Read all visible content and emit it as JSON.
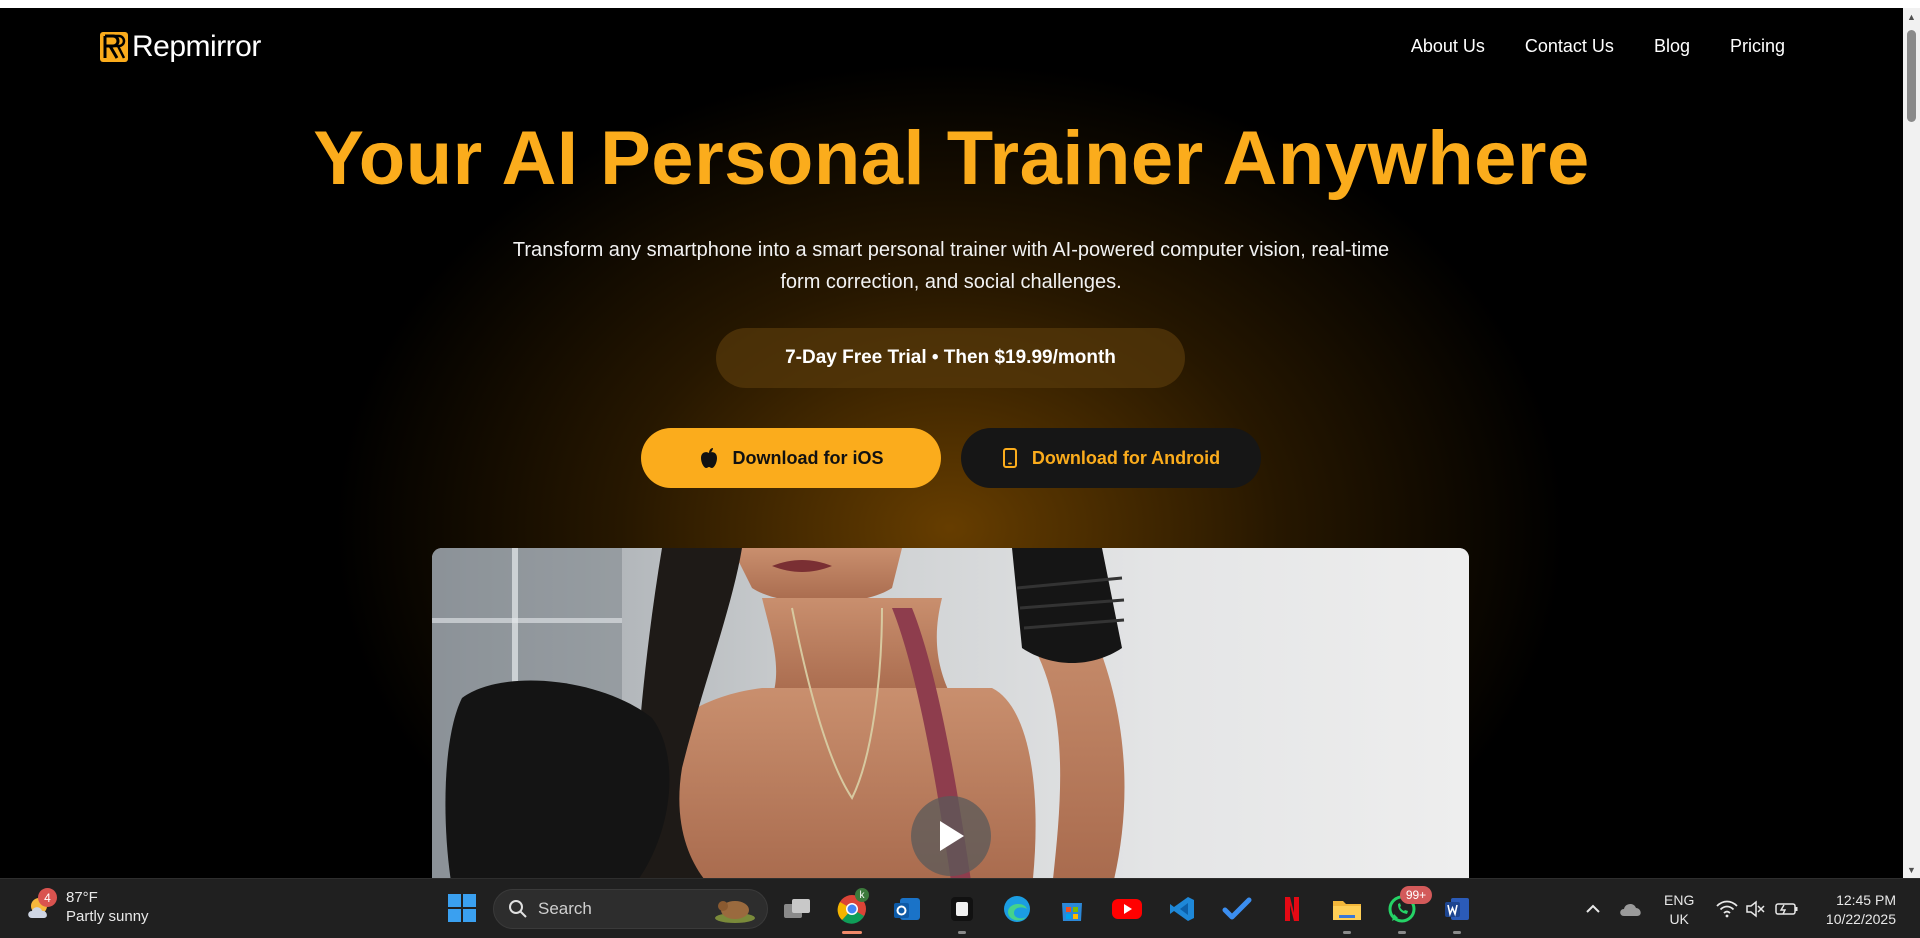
{
  "brand": {
    "name": "Repmirror",
    "accent": "#fbac1c"
  },
  "nav": {
    "links": [
      "About Us",
      "Contact Us",
      "Blog",
      "Pricing"
    ]
  },
  "hero": {
    "title": "Your AI Personal Trainer Anywhere",
    "subtitle_line1": "Transform any smartphone into a smart personal trainer with AI-powered computer vision, real-time",
    "subtitle_line2": "form correction, and social challenges.",
    "pricing_pill": "7-Day Free Trial • Then $19.99/month",
    "ios_button": "Download for iOS",
    "android_button": "Download for Android"
  },
  "video": {
    "play_icon": "play-icon"
  },
  "taskbar": {
    "weather": {
      "temp": "87°F",
      "condition": "Partly sunny",
      "badge": "4"
    },
    "search_placeholder": "Search",
    "whatsapp_badge": "99+",
    "chrome_profile": "k",
    "lang_line1": "ENG",
    "lang_line2": "UK",
    "time": "12:45 PM",
    "date": "10/22/2025"
  }
}
